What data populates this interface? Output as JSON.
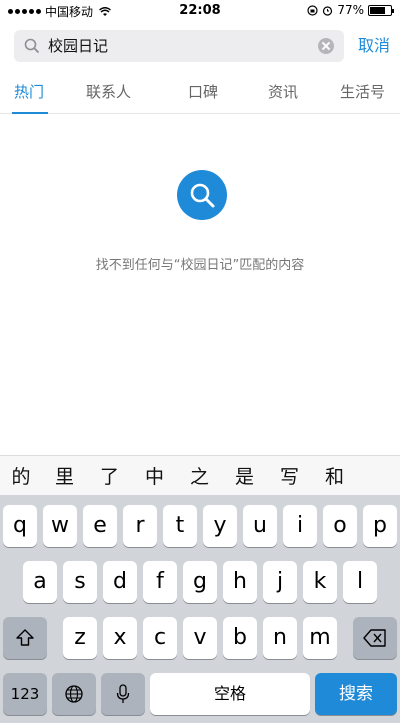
{
  "status_bar": {
    "carrier": "中国移动",
    "time": "22:08",
    "battery_percent_text": "77%",
    "battery_level": 0.77
  },
  "search": {
    "value": "校园日记",
    "cancel_label": "取消"
  },
  "tabs": [
    {
      "label": "热门"
    },
    {
      "label": "联系人"
    },
    {
      "label": "口碑"
    },
    {
      "label": "资讯"
    },
    {
      "label": "生活号"
    }
  ],
  "empty_state": {
    "message": "找不到任何与“校园日记”匹配的内容"
  },
  "candidates": [
    "的",
    "里",
    "了",
    "中",
    "之",
    "是",
    "写",
    "和"
  ],
  "keyboard": {
    "row1": [
      "q",
      "w",
      "e",
      "r",
      "t",
      "y",
      "u",
      "i",
      "o",
      "p"
    ],
    "row2": [
      "a",
      "s",
      "d",
      "f",
      "g",
      "h",
      "j",
      "k",
      "l"
    ],
    "row3": [
      "z",
      "x",
      "c",
      "v",
      "b",
      "n",
      "m"
    ],
    "numbers_label": "123",
    "space_label": "空格",
    "search_label": "搜索"
  },
  "colors": {
    "accent": "#1f8bd8",
    "keyboard_bg": "#d1d4d9"
  }
}
